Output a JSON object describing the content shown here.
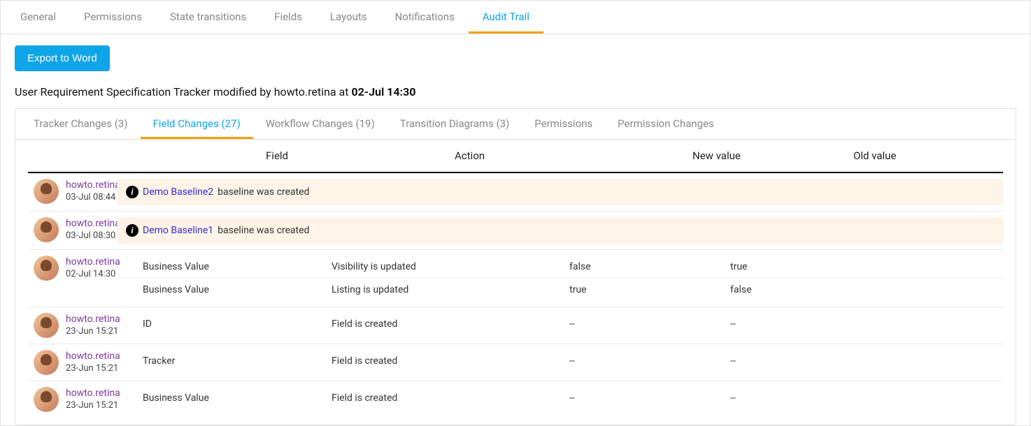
{
  "top_tabs": [
    {
      "label": "General"
    },
    {
      "label": "Permissions"
    },
    {
      "label": "State transitions"
    },
    {
      "label": "Fields"
    },
    {
      "label": "Layouts"
    },
    {
      "label": "Notifications"
    },
    {
      "label": "Audit Trail",
      "active": true
    }
  ],
  "export_label": "Export to Word",
  "summary_prefix": "User Requirement Specification Tracker modified by howto.retina at ",
  "summary_time": "02-Jul 14:30",
  "sub_tabs": [
    {
      "label": "Tracker Changes (3)"
    },
    {
      "label": "Field Changes (27)",
      "active": true
    },
    {
      "label": "Workflow Changes (19)"
    },
    {
      "label": "Transition Diagrams (3)"
    },
    {
      "label": "Permissions"
    },
    {
      "label": "Permission Changes"
    }
  ],
  "columns": {
    "field": "Field",
    "action": "Action",
    "new_value": "New value",
    "old_value": "Old value"
  },
  "baseline_suffix": " baseline was created",
  "rows": [
    {
      "user": "howto.retina",
      "time": "03-Jul 08:44",
      "baseline": {
        "name": "Demo Baseline2"
      }
    },
    {
      "user": "howto.retina",
      "time": "03-Jul 08:30",
      "baseline": {
        "name": "Demo Baseline1"
      }
    },
    {
      "user": "howto.retina",
      "time": "02-Jul 14:30",
      "changes": [
        {
          "field": "Business Value",
          "action": "Visibility is updated",
          "new_value": "false",
          "old_value": "true"
        },
        {
          "field": "Business Value",
          "action": "Listing is updated",
          "new_value": "true",
          "old_value": "false"
        }
      ]
    },
    {
      "user": "howto.retina",
      "time": "23-Jun 15:21",
      "changes": [
        {
          "field": "ID",
          "action": "Field is created",
          "new_value": "--",
          "old_value": "--"
        }
      ]
    },
    {
      "user": "howto.retina",
      "time": "23-Jun 15:21",
      "changes": [
        {
          "field": "Tracker",
          "action": "Field is created",
          "new_value": "--",
          "old_value": "--"
        }
      ]
    },
    {
      "user": "howto.retina",
      "time": "23-Jun 15:21",
      "changes": [
        {
          "field": "Business Value",
          "action": "Field is created",
          "new_value": "--",
          "old_value": "--"
        }
      ]
    }
  ]
}
